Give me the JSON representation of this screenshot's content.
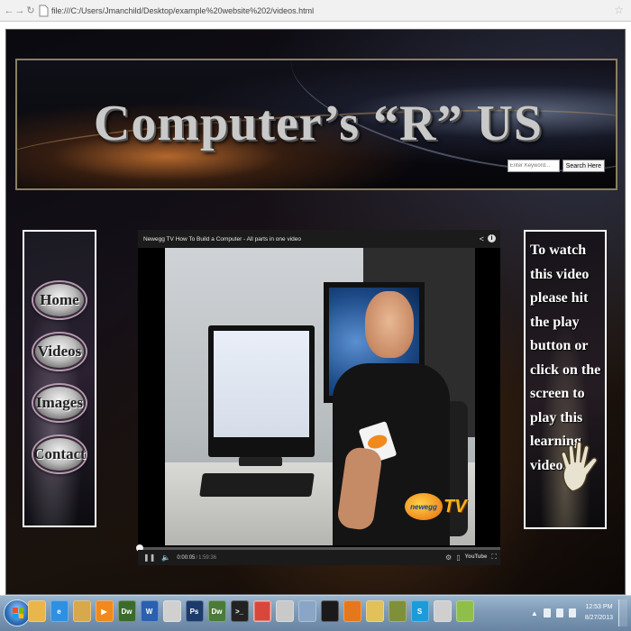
{
  "browser": {
    "url": "file:///C:/Users/Jmanchild/Desktop/example%20website%202/videos.html"
  },
  "site": {
    "title": "Computer’s “R” US",
    "search": {
      "placeholder": "Enter Keyword...",
      "button_label": "Search Here"
    },
    "nav": [
      {
        "label": "Home"
      },
      {
        "label": "Videos"
      },
      {
        "label": "Images"
      },
      {
        "label": "Contact"
      }
    ],
    "info_text": "To watch this video please hit the play button or click on the screen to play this learning video."
  },
  "player": {
    "title": "Newegg TV How To Build a Computer - All parts in one video",
    "time_current": "0:00:05",
    "time_separator": "/",
    "time_total": "1:59:36",
    "progress_fraction": 0.0007,
    "logo_text": "newegg",
    "logo_tv": "TV",
    "youtube_label": "YouTube"
  },
  "taskbar": {
    "apps": [
      {
        "name": "explorer-icon",
        "color": "#e8b64a",
        "label": ""
      },
      {
        "name": "ie-icon",
        "color": "#2f8fe0",
        "label": "e"
      },
      {
        "name": "libraries-icon",
        "color": "#d8a84c",
        "label": ""
      },
      {
        "name": "media-player-icon",
        "color": "#f08a1c",
        "label": "▶"
      },
      {
        "name": "dreamweaver-icon",
        "color": "#3a6b2a",
        "label": "Dw"
      },
      {
        "name": "word-icon",
        "color": "#2b5fb0",
        "label": "W"
      },
      {
        "name": "paint-icon",
        "color": "#d0d0d0",
        "label": ""
      },
      {
        "name": "photoshop-icon",
        "color": "#1c3b6b",
        "label": "Ps"
      },
      {
        "name": "dreamweaver2-icon",
        "color": "#4a7b38",
        "label": "Dw"
      },
      {
        "name": "cmd-icon",
        "color": "#222222",
        "label": ">_"
      },
      {
        "name": "chrome-icon",
        "color": "#d9473a",
        "label": ""
      },
      {
        "name": "app-icon",
        "color": "#c9c9c9",
        "label": ""
      },
      {
        "name": "shield-icon",
        "color": "#8aa6c6",
        "label": ""
      },
      {
        "name": "winamp-icon",
        "color": "#1a1a1a",
        "label": ""
      },
      {
        "name": "firefox-icon",
        "color": "#e5781c",
        "label": ""
      },
      {
        "name": "folder-icon",
        "color": "#e2c05a",
        "label": ""
      },
      {
        "name": "shell-icon",
        "color": "#7f8f3a",
        "label": ""
      },
      {
        "name": "skype-icon",
        "color": "#1d9bd8",
        "label": "S"
      },
      {
        "name": "steam-icon",
        "color": "#cfcfcf",
        "label": ""
      },
      {
        "name": "network-icon",
        "color": "#8fbf4a",
        "label": ""
      }
    ],
    "clock_time": "12:53 PM",
    "clock_date": "8/27/2013"
  }
}
